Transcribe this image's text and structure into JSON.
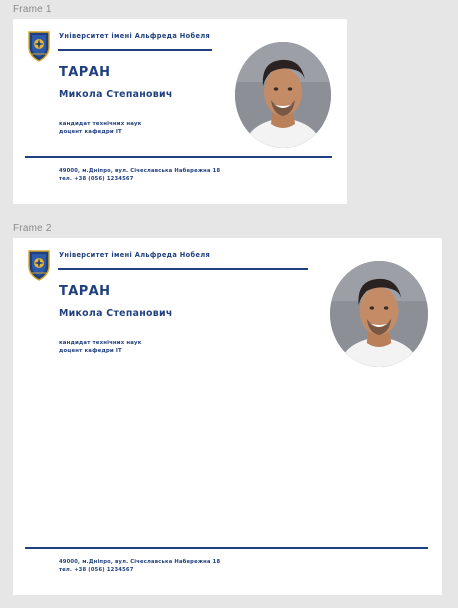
{
  "canvas": {
    "frames": [
      {
        "label": "Frame 1",
        "card": {
          "university": "Університет імені Альфреда Нобеля",
          "surname": "ТАРАН",
          "given_names": "Микола  Степанович",
          "degree": "кандидат технічних наук",
          "position": "доцент кафедри ІТ",
          "address": "49000,  м.Дніпро,  вул.  Січеславська Набережна 18",
          "phone": "тел.  +38  (056)  1234567"
        }
      },
      {
        "label": "Frame 2",
        "card": {
          "university": "Університет імені Альфреда Нобеля",
          "surname": "ТАРАН",
          "given_names": "Микола  Степанович",
          "degree": "кандидат технічних наук",
          "position": "доцент кафедри ІТ",
          "address": "49000,  м.Дніпро,  вул.  Січеславська Набережна 18",
          "phone": "тел.  +38  (056)  1234567"
        }
      }
    ]
  },
  "colors": {
    "canvas_background": "#e6e6e6",
    "frame_background": "#ffffff",
    "brand_blue": "#1f3f7e",
    "frame_label": "#8a8a8a"
  },
  "icons": {
    "logo": "university-crest-icon",
    "photo": "portrait-photo"
  }
}
